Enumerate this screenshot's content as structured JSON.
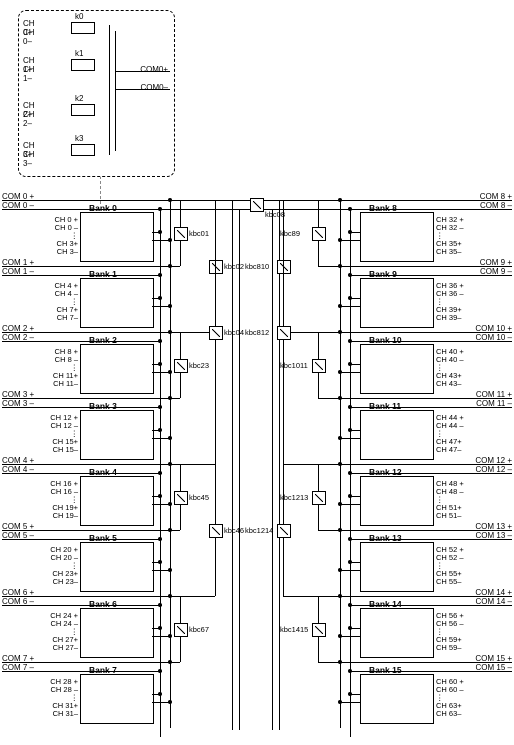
{
  "detail": {
    "rows": [
      {
        "pos": "CH 0+",
        "neg": "CH 0–",
        "sw": "k0"
      },
      {
        "pos": "CH 1+",
        "neg": "CH 1–",
        "sw": "k1"
      },
      {
        "pos": "CH 2+",
        "neg": "CH 2–",
        "sw": "k2"
      },
      {
        "pos": "CH 3+",
        "neg": "CH 3–",
        "sw": "k3"
      }
    ],
    "com_pos": "COM0+",
    "com_neg": "COM0–"
  },
  "left_banks": [
    {
      "name": "Bank 0",
      "com_pos": "COM 0 +",
      "com_neg": "COM 0 –",
      "ch_a_pos": "CH 0 +",
      "ch_a_neg": "CH 0 –",
      "ch_b_pos": "CH 3+",
      "ch_b_neg": "CH 3–"
    },
    {
      "name": "Bank 1",
      "com_pos": "COM 1 +",
      "com_neg": "COM 1 –",
      "ch_a_pos": "CH 4 +",
      "ch_a_neg": "CH 4 –",
      "ch_b_pos": "CH 7+",
      "ch_b_neg": "CH 7–"
    },
    {
      "name": "Bank 2",
      "com_pos": "COM 2 +",
      "com_neg": "COM 2 –",
      "ch_a_pos": "CH 8 +",
      "ch_a_neg": "CH 8 –",
      "ch_b_pos": "CH 11+",
      "ch_b_neg": "CH 11–"
    },
    {
      "name": "Bank 3",
      "com_pos": "COM 3 +",
      "com_neg": "COM 3 –",
      "ch_a_pos": "CH 12 +",
      "ch_a_neg": "CH 12 –",
      "ch_b_pos": "CH 15+",
      "ch_b_neg": "CH 15–"
    },
    {
      "name": "Bank 4",
      "com_pos": "COM 4 +",
      "com_neg": "COM 4 –",
      "ch_a_pos": "CH 16 +",
      "ch_a_neg": "CH 16 –",
      "ch_b_pos": "CH 19+",
      "ch_b_neg": "CH 19–"
    },
    {
      "name": "Bank 5",
      "com_pos": "COM 5 +",
      "com_neg": "COM 5 –",
      "ch_a_pos": "CH 20 +",
      "ch_a_neg": "CH 20 –",
      "ch_b_pos": "CH 23+",
      "ch_b_neg": "CH 23–"
    },
    {
      "name": "Bank 6",
      "com_pos": "COM 6 +",
      "com_neg": "COM 6 –",
      "ch_a_pos": "CH 24 +",
      "ch_a_neg": "CH 24 –",
      "ch_b_pos": "CH 27+",
      "ch_b_neg": "CH 27–"
    },
    {
      "name": "Bank 7",
      "com_pos": "COM 7 +",
      "com_neg": "COM 7 –",
      "ch_a_pos": "CH 28 +",
      "ch_a_neg": "CH 28 –",
      "ch_b_pos": "CH 31+",
      "ch_b_neg": "CH 31–"
    }
  ],
  "right_banks": [
    {
      "name": "Bank 8",
      "com_pos": "COM 8 +",
      "com_neg": "COM 8 –",
      "ch_a_pos": "CH 32 +",
      "ch_a_neg": "CH 32 –",
      "ch_b_pos": "CH 35+",
      "ch_b_neg": "CH 35–"
    },
    {
      "name": "Bank 9",
      "com_pos": "COM 9 +",
      "com_neg": "COM 9 –",
      "ch_a_pos": "CH 36 +",
      "ch_a_neg": "CH 36 –",
      "ch_b_pos": "CH 39+",
      "ch_b_neg": "CH 39–"
    },
    {
      "name": "Bank 10",
      "com_pos": "COM 10 +",
      "com_neg": "COM 10 –",
      "ch_a_pos": "CH 40 +",
      "ch_a_neg": "CH 40 –",
      "ch_b_pos": "CH 43+",
      "ch_b_neg": "CH 43–"
    },
    {
      "name": "Bank 11",
      "com_pos": "COM 11 +",
      "com_neg": "COM 11 –",
      "ch_a_pos": "CH 44 +",
      "ch_a_neg": "CH 44 –",
      "ch_b_pos": "CH 47+",
      "ch_b_neg": "CH 47–"
    },
    {
      "name": "Bank 12",
      "com_pos": "COM 12 +",
      "com_neg": "COM 12 –",
      "ch_a_pos": "CH 48 +",
      "ch_a_neg": "CH 48 –",
      "ch_b_pos": "CH 51+",
      "ch_b_neg": "CH 51–"
    },
    {
      "name": "Bank 13",
      "com_pos": "COM 13 +",
      "com_neg": "COM 13 –",
      "ch_a_pos": "CH 52 +",
      "ch_a_neg": "CH 52 –",
      "ch_b_pos": "CH 55+",
      "ch_b_neg": "CH 55–"
    },
    {
      "name": "Bank 14",
      "com_pos": "COM 14 +",
      "com_neg": "COM 14 –",
      "ch_a_pos": "CH 56 +",
      "ch_a_neg": "CH 56 –",
      "ch_b_pos": "CH 59+",
      "ch_b_neg": "CH 59–"
    },
    {
      "name": "Bank 15",
      "com_pos": "COM 15 +",
      "com_neg": "COM 15 –",
      "ch_a_pos": "CH 60 +",
      "ch_a_neg": "CH 60 –",
      "ch_b_pos": "CH 63+",
      "ch_b_neg": "CH 63–"
    }
  ],
  "left_relays": [
    "kbc01",
    "kbc02",
    "kbc23",
    "kbc04",
    "kbc45",
    "kbc46",
    "kbc67"
  ],
  "right_relays": [
    "kbc89",
    "kbc810",
    "kbc1011",
    "kbc812",
    "kbc1213",
    "kbc1214",
    "kbc1415"
  ],
  "top_relay": "kbc08"
}
